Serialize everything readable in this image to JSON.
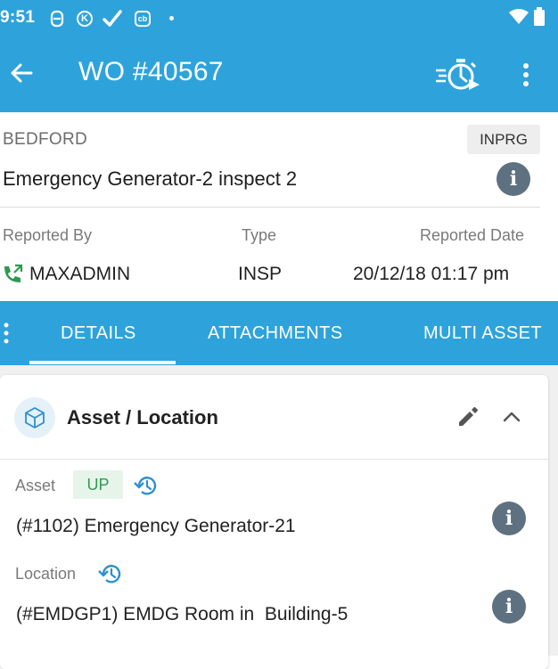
{
  "status_bar": {
    "time": "9:51",
    "k_badge": "K",
    "cb_badge": "cb"
  },
  "app_bar": {
    "title": "WO #40567"
  },
  "work_order": {
    "site": "BEDFORD",
    "status": "INPRG",
    "description": "Emergency Generator-2 inspect 2",
    "reported_by_label": "Reported By",
    "reported_by": "MAXADMIN",
    "type_label": "Type",
    "type": "INSP",
    "reported_date_label": "Reported Date",
    "reported_date": "20/12/18 01:17 pm"
  },
  "tabs": [
    {
      "label": "DETAILS",
      "selected": true
    },
    {
      "label": "ATTACHMENTS",
      "selected": false
    },
    {
      "label": "MULTI ASSET",
      "selected": false
    }
  ],
  "asset_location": {
    "title": "Asset / Location",
    "asset_label": "Asset",
    "asset_status": "UP",
    "asset_value": "(#1102) Emergency Generator-21",
    "location_label": "Location",
    "location_value": "(#EMDGP1) EMDG Room in  Building-5"
  },
  "colors": {
    "primary": "#2ea3db",
    "info_button": "#5e7181",
    "up_badge_text": "#2e9a4f",
    "up_badge_bg": "#e6f4ea",
    "accent_icon": "#2e8fd0",
    "phone_green": "#2e9a4f"
  },
  "icons": [
    "sync-icon",
    "k-icon",
    "check-icon",
    "cb-icon",
    "dot-icon",
    "wifi-icon",
    "battery-icon",
    "back-arrow-icon",
    "timer-icon",
    "overflow-menu-icon",
    "info-icon",
    "phone-callback-icon",
    "cube-icon",
    "edit-pencil-icon",
    "chevron-up-icon",
    "history-icon"
  ]
}
